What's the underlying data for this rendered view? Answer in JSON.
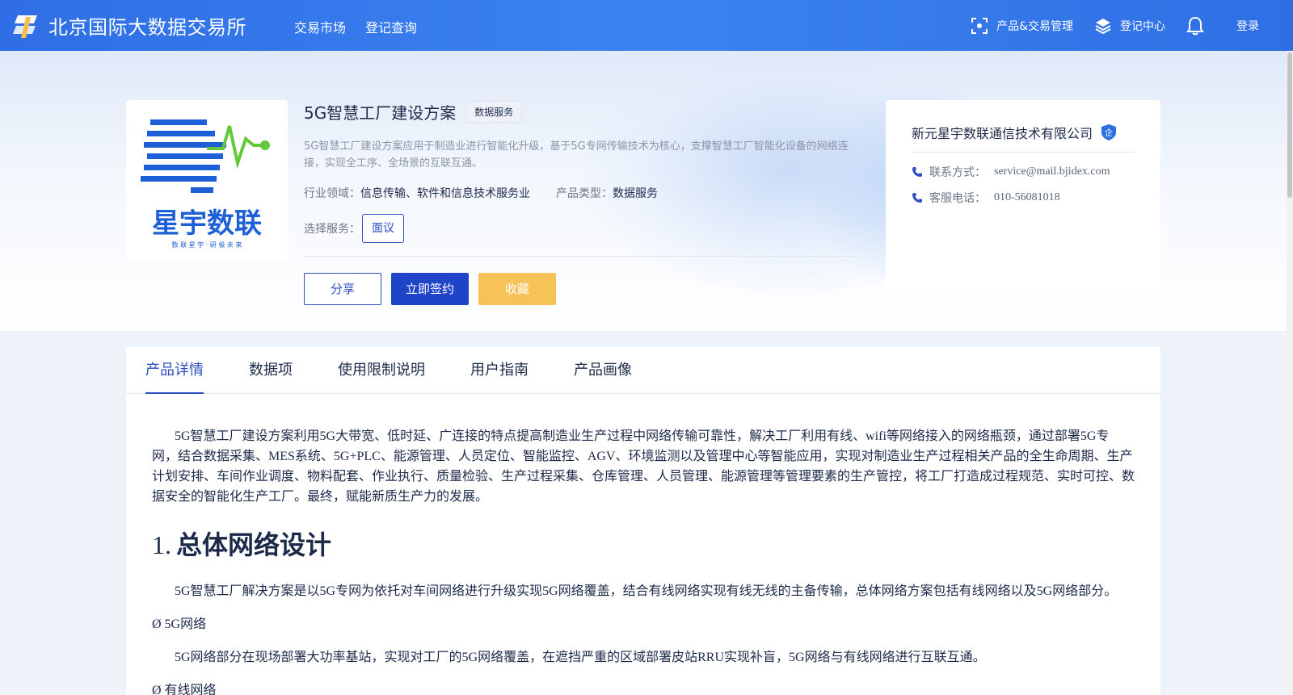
{
  "header": {
    "brand": "北京国际大数据交易所",
    "nav": [
      "交易市场",
      "登记查询"
    ],
    "product_mgmt": "产品&交易管理",
    "registry_center": "登记中心",
    "login": "登录"
  },
  "product": {
    "title": "5G智慧工厂建设方案",
    "tag": "数据服务",
    "description": "5G智慧工厂建设方案应用于制造业进行智能化升级，基于5G专网传输技术为核心，支撑智慧工厂智能化设备的网络连接，实现全工序、全场景的互联互通。",
    "industry_label": "行业领域：",
    "industry_value": "信息传输、软件和信息技术服务业",
    "type_label": "产品类型：",
    "type_value": "数据服务",
    "service_label": "选择服务：",
    "service_option": "面议",
    "share": "分享",
    "sign": "立即签约",
    "favorite": "收藏"
  },
  "logo": {
    "company_text": "星宇数联",
    "slogan": "数 联 星 宇 · 研 极 未 来"
  },
  "company": {
    "name": "新元星宇数联通信技术有限公司",
    "badge": "企",
    "contact_label": "联系方式：",
    "contact_value": "service@mail.bjidex.com",
    "phone_label": "客服电话：",
    "phone_value": "010-56081018"
  },
  "tabs": [
    "产品详情",
    "数据项",
    "使用限制说明",
    "用户指南",
    "产品画像"
  ],
  "content": {
    "intro": "5G智慧工厂建设方案利用5G大带宽、低时延、广连接的特点提高制造业生产过程中网络传输可靠性，解决工厂利用有线、wifi等网络接入的网络瓶颈，通过部署5G专网，结合数据采集、MES系统、5G+PLC、能源管理、人员定位、智能监控、AGV、环境监测以及管理中心等智能应用，实现对制造业生产过程相关产品的全生命周期、生产计划安排、车间作业调度、物料配套、作业执行、质量检验、生产过程采集、仓库管理、人员管理、能源管理等管理要素的生产管控，将工厂打造成过程规范、实时可控、数据安全的智能化生产工厂。最终，赋能新质生产力的发展。",
    "h1_num": "1.",
    "h1_text": "总体网络设计",
    "p1": "5G智慧工厂解决方案是以5G专网为依托对车间网络进行升级实现5G网络覆盖，结合有线网络实现有线无线的主备传输，总体网络方案包括有线网络以及5G网络部分。",
    "b1": "Ø 5G网络",
    "p2": "5G网络部分在现场部署大功率基站，实现对工厂的5G网络覆盖，在遮挡严重的区域部署皮站RRU实现补盲，5G网络与有线网络进行互联互通。",
    "b2": "Ø 有线网络"
  }
}
